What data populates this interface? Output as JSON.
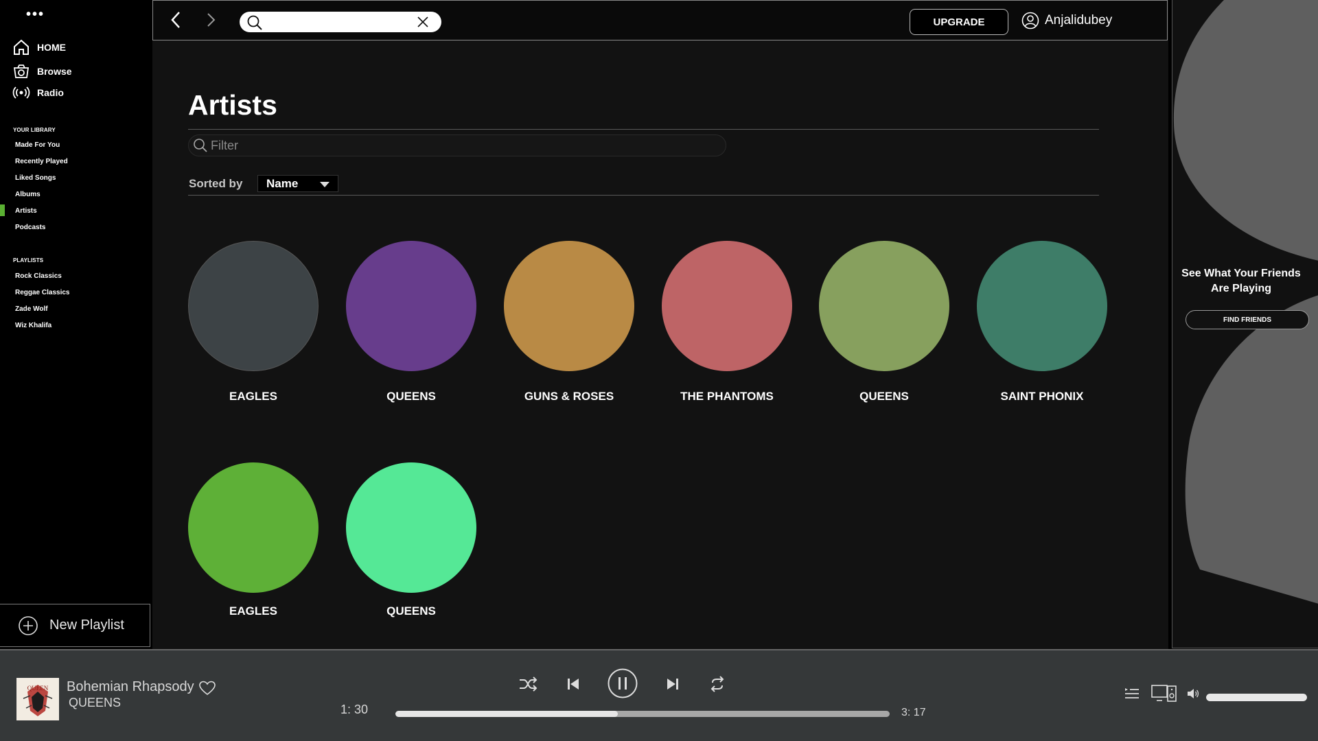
{
  "sidebar": {
    "menu_glyph": "•••",
    "nav": [
      {
        "label": "HOME",
        "icon": "home-icon"
      },
      {
        "label": "Browse",
        "icon": "browse-icon"
      },
      {
        "label": "Radio",
        "icon": "radio-icon"
      }
    ],
    "library_heading": "YOUR LIBRARY",
    "library": [
      "Made For You",
      "Recently Played",
      "Liked Songs",
      "Albums",
      "Artists",
      "Podcasts"
    ],
    "active_library_item": "Artists",
    "playlists_heading": "PLAYLISTS",
    "playlists": [
      "Rock Classics",
      "Reggae Classics",
      "Zade Wolf",
      "Wiz Khalifa"
    ],
    "new_playlist_label": "New Playlist"
  },
  "topbar": {
    "search_value": "",
    "upgrade_label": "UPGRADE",
    "username": "Anjalidubey"
  },
  "main": {
    "title": "Artists",
    "filter_placeholder": "Filter",
    "sorted_by_label": "Sorted by",
    "sort_value": "Name",
    "artists": [
      {
        "name": "EAGLES",
        "color": "#3d4346"
      },
      {
        "name": "QUEENS",
        "color": "#673d8c"
      },
      {
        "name": "GUNS & ROSES",
        "color": "#b98a45"
      },
      {
        "name": "THE PHANTOMS",
        "color": "#be6466"
      },
      {
        "name": "QUEENS",
        "color": "#87a05e"
      },
      {
        "name": "SAINT PHONIX",
        "color": "#3e7d68"
      },
      {
        "name": "EAGLES",
        "color": "#5eb037"
      },
      {
        "name": "QUEENS",
        "color": "#55e896"
      }
    ]
  },
  "friends_panel": {
    "heading": "See What Your Friends Are Playing",
    "button_label": "FIND FRIENDS"
  },
  "player": {
    "track_title": "Bohemian Rhapsody",
    "track_artist": "QUEENS",
    "cover_text": "QUEEN",
    "time_current": "1: 30",
    "time_total": "3: 17",
    "progress_fraction": 0.45,
    "volume_fraction": 1.0,
    "colors": {
      "accent": "#5ab032",
      "bar_bg": "#353839"
    }
  }
}
